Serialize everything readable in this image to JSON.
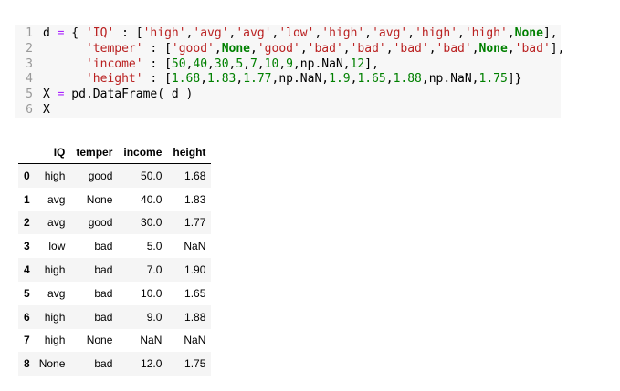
{
  "code_cell": {
    "lines": [
      {
        "no": "1",
        "tokens": [
          {
            "t": "d ",
            "c": "p"
          },
          {
            "t": "=",
            "c": "o"
          },
          {
            "t": " { ",
            "c": "p"
          },
          {
            "t": "'IQ'",
            "c": "s"
          },
          {
            "t": " : [",
            "c": "p"
          },
          {
            "t": "'high'",
            "c": "s"
          },
          {
            "t": ",",
            "c": "p"
          },
          {
            "t": "'avg'",
            "c": "s"
          },
          {
            "t": ",",
            "c": "p"
          },
          {
            "t": "'avg'",
            "c": "s"
          },
          {
            "t": ",",
            "c": "p"
          },
          {
            "t": "'low'",
            "c": "s"
          },
          {
            "t": ",",
            "c": "p"
          },
          {
            "t": "'high'",
            "c": "s"
          },
          {
            "t": ",",
            "c": "p"
          },
          {
            "t": "'avg'",
            "c": "s"
          },
          {
            "t": ",",
            "c": "p"
          },
          {
            "t": "'high'",
            "c": "s"
          },
          {
            "t": ",",
            "c": "p"
          },
          {
            "t": "'high'",
            "c": "s"
          },
          {
            "t": ",",
            "c": "p"
          },
          {
            "t": "None",
            "c": "k"
          },
          {
            "t": "],",
            "c": "p"
          }
        ]
      },
      {
        "no": "2",
        "tokens": [
          {
            "t": "      ",
            "c": "p"
          },
          {
            "t": "'temper'",
            "c": "s"
          },
          {
            "t": " : [",
            "c": "p"
          },
          {
            "t": "'good'",
            "c": "s"
          },
          {
            "t": ",",
            "c": "p"
          },
          {
            "t": "None",
            "c": "k"
          },
          {
            "t": ",",
            "c": "p"
          },
          {
            "t": "'good'",
            "c": "s"
          },
          {
            "t": ",",
            "c": "p"
          },
          {
            "t": "'bad'",
            "c": "s"
          },
          {
            "t": ",",
            "c": "p"
          },
          {
            "t": "'bad'",
            "c": "s"
          },
          {
            "t": ",",
            "c": "p"
          },
          {
            "t": "'bad'",
            "c": "s"
          },
          {
            "t": ",",
            "c": "p"
          },
          {
            "t": "'bad'",
            "c": "s"
          },
          {
            "t": ",",
            "c": "p"
          },
          {
            "t": "None",
            "c": "k"
          },
          {
            "t": ",",
            "c": "p"
          },
          {
            "t": "'bad'",
            "c": "s"
          },
          {
            "t": "],",
            "c": "p"
          }
        ]
      },
      {
        "no": "3",
        "tokens": [
          {
            "t": "      ",
            "c": "p"
          },
          {
            "t": "'income'",
            "c": "s"
          },
          {
            "t": " : [",
            "c": "p"
          },
          {
            "t": "50",
            "c": "n"
          },
          {
            "t": ",",
            "c": "p"
          },
          {
            "t": "40",
            "c": "n"
          },
          {
            "t": ",",
            "c": "p"
          },
          {
            "t": "30",
            "c": "n"
          },
          {
            "t": ",",
            "c": "p"
          },
          {
            "t": "5",
            "c": "n"
          },
          {
            "t": ",",
            "c": "p"
          },
          {
            "t": "7",
            "c": "n"
          },
          {
            "t": ",",
            "c": "p"
          },
          {
            "t": "10",
            "c": "n"
          },
          {
            "t": ",",
            "c": "p"
          },
          {
            "t": "9",
            "c": "n"
          },
          {
            "t": ",np.NaN,",
            "c": "p"
          },
          {
            "t": "12",
            "c": "n"
          },
          {
            "t": "],",
            "c": "p"
          }
        ]
      },
      {
        "no": "4",
        "tokens": [
          {
            "t": "      ",
            "c": "p"
          },
          {
            "t": "'height'",
            "c": "s"
          },
          {
            "t": " : [",
            "c": "p"
          },
          {
            "t": "1.68",
            "c": "n"
          },
          {
            "t": ",",
            "c": "p"
          },
          {
            "t": "1.83",
            "c": "n"
          },
          {
            "t": ",",
            "c": "p"
          },
          {
            "t": "1.77",
            "c": "n"
          },
          {
            "t": ",np.NaN,",
            "c": "p"
          },
          {
            "t": "1.9",
            "c": "n"
          },
          {
            "t": ",",
            "c": "p"
          },
          {
            "t": "1.65",
            "c": "n"
          },
          {
            "t": ",",
            "c": "p"
          },
          {
            "t": "1.88",
            "c": "n"
          },
          {
            "t": ",np.NaN,",
            "c": "p"
          },
          {
            "t": "1.75",
            "c": "n"
          },
          {
            "t": "]}",
            "c": "p"
          }
        ]
      },
      {
        "no": "5",
        "tokens": [
          {
            "t": "X ",
            "c": "p"
          },
          {
            "t": "=",
            "c": "o"
          },
          {
            "t": " pd.DataFrame( d )",
            "c": "p"
          }
        ]
      },
      {
        "no": "6",
        "tokens": [
          {
            "t": "X",
            "c": "p"
          }
        ]
      }
    ]
  },
  "dataframe": {
    "columns": [
      "",
      "IQ",
      "temper",
      "income",
      "height"
    ],
    "rows": [
      [
        "0",
        "high",
        "good",
        "50.0",
        "1.68"
      ],
      [
        "1",
        "avg",
        "None",
        "40.0",
        "1.83"
      ],
      [
        "2",
        "avg",
        "good",
        "30.0",
        "1.77"
      ],
      [
        "3",
        "low",
        "bad",
        "5.0",
        "NaN"
      ],
      [
        "4",
        "high",
        "bad",
        "7.0",
        "1.90"
      ],
      [
        "5",
        "avg",
        "bad",
        "10.0",
        "1.65"
      ],
      [
        "6",
        "high",
        "bad",
        "9.0",
        "1.88"
      ],
      [
        "7",
        "high",
        "None",
        "NaN",
        "NaN"
      ],
      [
        "8",
        "None",
        "bad",
        "12.0",
        "1.75"
      ]
    ]
  },
  "colors": {
    "code_background": "#f7f7f7",
    "string": "#ba2121",
    "number": "#008000",
    "keyword": "#008000",
    "operator": "#aa22ff",
    "line_number": "#999999",
    "striped_row": "#f5f5f5"
  }
}
